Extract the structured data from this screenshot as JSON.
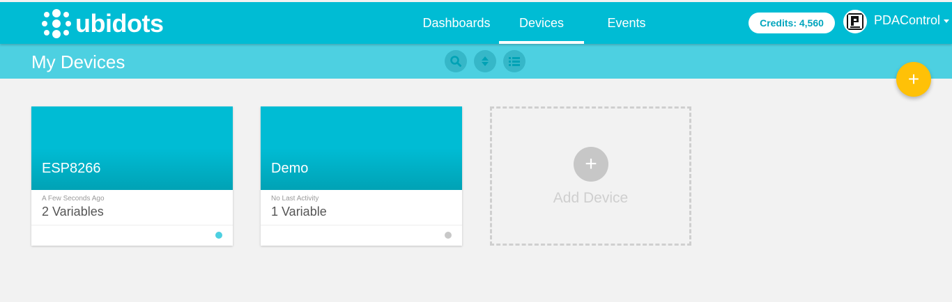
{
  "brand": {
    "name": "ubidots"
  },
  "nav": {
    "items": [
      {
        "label": "Dashboards",
        "active": false
      },
      {
        "label": "Devices",
        "active": true
      },
      {
        "label": "Events",
        "active": false
      }
    ]
  },
  "account": {
    "credits": "Credits: 4,560",
    "username": "PDAControl"
  },
  "subheader": {
    "title": "My Devices"
  },
  "toolbar": {
    "icons": [
      "search-icon",
      "sort-icon",
      "list-icon"
    ]
  },
  "fab": {
    "label": "+"
  },
  "devices": [
    {
      "name": "ESP8266",
      "last_activity": "A Few Seconds Ago",
      "variables": "2 Variables",
      "status_color": "#4dd0e1"
    },
    {
      "name": "Demo",
      "last_activity": "No Last Activity",
      "variables": "1 Variable",
      "status_color": "#c8c8c8"
    }
  ],
  "add_device": {
    "icon": "+",
    "label": "Add Device"
  },
  "colors": {
    "primary": "#00bcd4",
    "secondary": "#4dd0e1",
    "accent": "#ffc107"
  }
}
